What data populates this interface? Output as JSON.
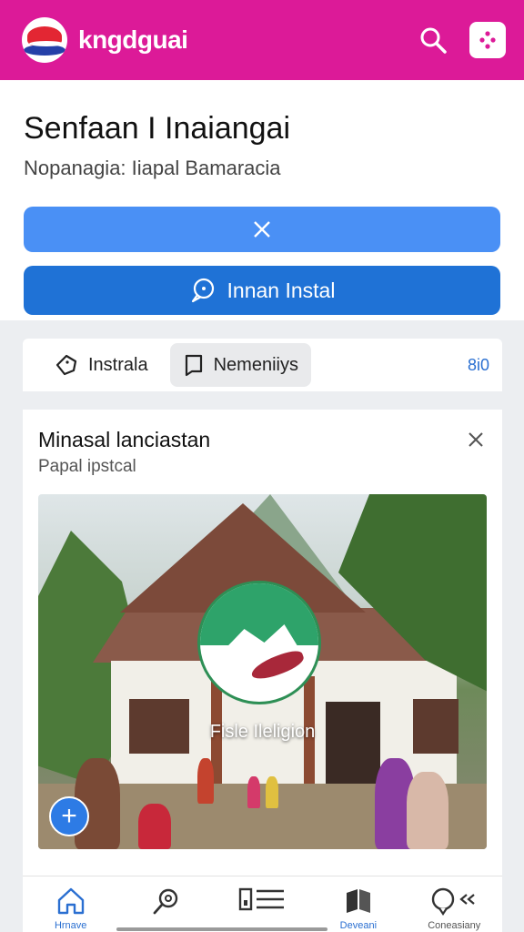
{
  "app": {
    "title": "kngdguai",
    "logo_icon": "brand-logo-icon",
    "brand_color": "#dc1a98"
  },
  "topbar": {
    "search_icon": "search-icon",
    "app_icon": "app-grid-icon"
  },
  "header": {
    "title": "Senfaan I Inaiangai",
    "subtitle": "Nopanagia: Iiapal Bamaracia",
    "close_button_icon": "close-icon",
    "primary_button_label": "Innan Instal",
    "primary_button_icon": "chat-bubble-icon",
    "button_colors": [
      "#4a90f5",
      "#1f72d6"
    ]
  },
  "tabs": [
    {
      "label": "Instrala",
      "icon": "tag-icon",
      "active": false
    },
    {
      "label": "Nemeniiys",
      "icon": "bookmark-icon",
      "active": true
    }
  ],
  "tab_count": "8i0",
  "card": {
    "title": "Minasal lanciastan",
    "subtitle": "Papal ipstcal",
    "close_icon": "close-icon",
    "image_caption": "Fisle Ileligion",
    "fab_label": "+"
  },
  "bottom_nav": [
    {
      "icon": "home-icon",
      "label": "Hrnave",
      "active": true
    },
    {
      "icon": "search-icon",
      "label": "",
      "active": false
    },
    {
      "icon": "list-icon",
      "label": "",
      "active": false
    },
    {
      "icon": "book-icon",
      "label": "Deveani",
      "active": false
    },
    {
      "icon": "chat-icon",
      "label": "Coneasiany",
      "active": false
    }
  ]
}
